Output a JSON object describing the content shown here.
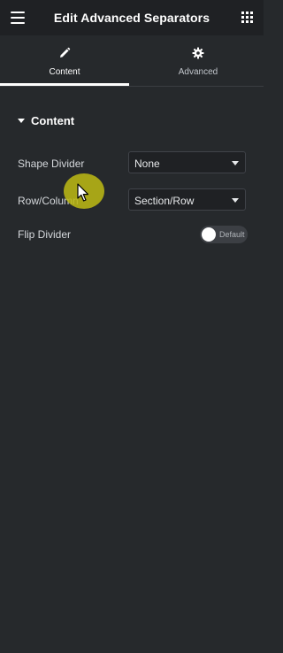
{
  "header": {
    "title": "Edit Advanced Separators",
    "menu_icon": "hamburger-icon",
    "apps_icon": "grid-icon"
  },
  "tabs": [
    {
      "label": "Content",
      "icon": "pencil-icon",
      "active": true
    },
    {
      "label": "Advanced",
      "icon": "gear-icon",
      "active": false
    }
  ],
  "section": {
    "title": "Content",
    "expanded": true
  },
  "controls": {
    "shape_divider": {
      "label": "Shape Divider",
      "value": "None"
    },
    "row_column": {
      "label": "Row/Column",
      "value": "Section/Row"
    },
    "flip_divider": {
      "label": "Flip Divider",
      "toggle_text": "Default",
      "on": false
    }
  },
  "colors": {
    "header_bg": "#1f2124",
    "panel_bg": "#26292c",
    "cursor_highlight": "#bab614"
  }
}
